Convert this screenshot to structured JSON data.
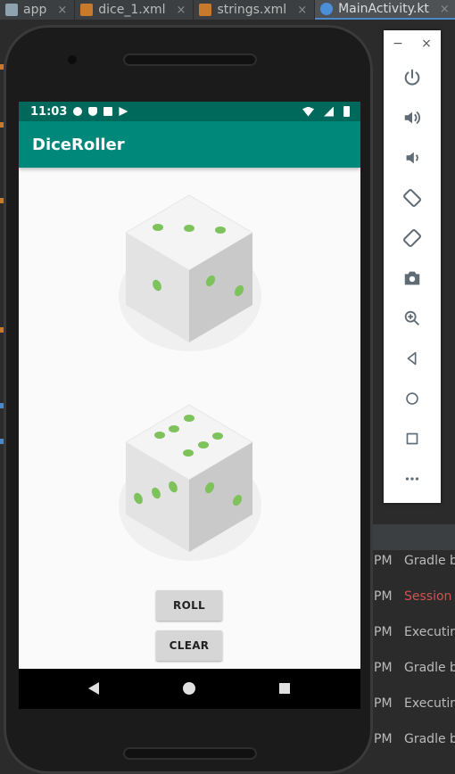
{
  "ide": {
    "tabs": [
      {
        "label": "app",
        "icon": "app-icon"
      },
      {
        "label": "dice_1.xml",
        "icon": "xml-file-icon"
      },
      {
        "label": "strings.xml",
        "icon": "xml-file-icon"
      },
      {
        "label": "MainActivity.kt",
        "icon": "kotlin-file-icon"
      }
    ],
    "close_glyph": "×"
  },
  "emulator_panel": {
    "minimize": "−",
    "close": "×",
    "buttons": [
      "power-icon",
      "volume-up-icon",
      "volume-down-icon",
      "rotate-left-icon",
      "rotate-right-icon",
      "camera-icon",
      "zoom-icon",
      "back-icon",
      "home-icon",
      "overview-icon",
      "more-icon"
    ]
  },
  "run_log": [
    {
      "time": "PM",
      "msg": "Gradle b",
      "error": false
    },
    {
      "time": "PM",
      "msg": "Session '",
      "error": true
    },
    {
      "time": "PM",
      "msg": "Executing",
      "error": false
    },
    {
      "time": "PM",
      "msg": "Gradle b",
      "error": false
    },
    {
      "time": "PM",
      "msg": "Executing",
      "error": false
    },
    {
      "time": "PM",
      "msg": "Gradle b",
      "error": false
    }
  ],
  "device": {
    "status_time": "11:03",
    "app_title": "DiceRoller",
    "dice": [
      {
        "top_pips": 3,
        "left_pips": 1,
        "right_pips": 2
      },
      {
        "top_pips": 6,
        "left_pips": 3,
        "right_pips": 2
      }
    ],
    "roll_label": "ROLL",
    "clear_label": "CLEAR",
    "colors": {
      "status": "#00695c",
      "appbar": "#00897b",
      "pip": "#7dc25b"
    }
  }
}
